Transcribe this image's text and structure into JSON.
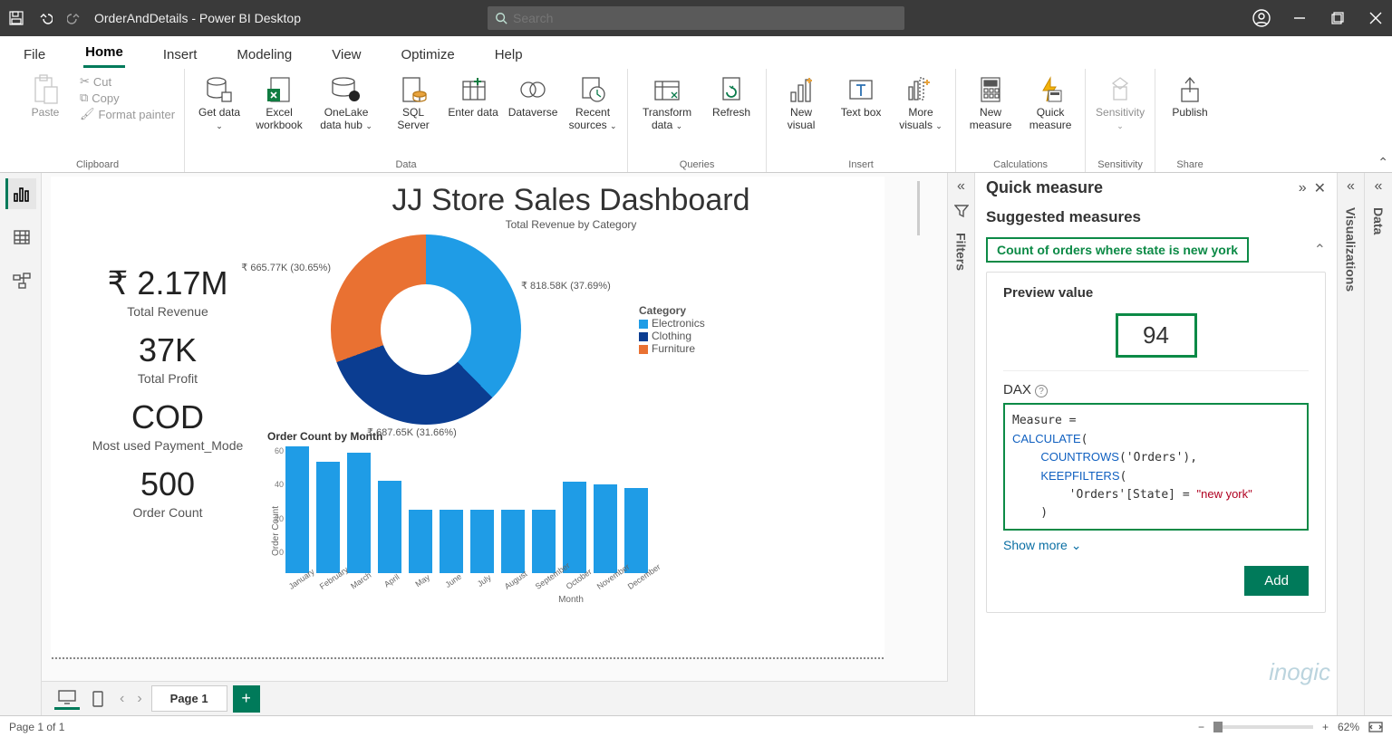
{
  "titlebar": {
    "title": "OrderAndDetails - Power BI Desktop",
    "search_placeholder": "Search"
  },
  "menu": [
    "File",
    "Home",
    "Insert",
    "Modeling",
    "View",
    "Optimize",
    "Help"
  ],
  "ribbon": {
    "clipboard": {
      "paste": "Paste",
      "cut": "Cut",
      "copy": "Copy",
      "format_painter": "Format painter",
      "label": "Clipboard"
    },
    "data": {
      "get_data": "Get data",
      "excel": "Excel workbook",
      "onelake": "OneLake data hub",
      "sql": "SQL Server",
      "enter": "Enter data",
      "dataverse": "Dataverse",
      "recent": "Recent sources",
      "label": "Data"
    },
    "queries": {
      "transform": "Transform data",
      "refresh": "Refresh",
      "label": "Queries"
    },
    "insert": {
      "new_visual": "New visual",
      "text_box": "Text box",
      "more_visuals": "More visuals",
      "label": "Insert"
    },
    "calculations": {
      "new_measure": "New measure",
      "quick_measure": "Quick measure",
      "label": "Calculations"
    },
    "sensitivity": {
      "btn": "Sensitivity",
      "label": "Sensitivity"
    },
    "share": {
      "publish": "Publish",
      "label": "Share"
    }
  },
  "report": {
    "title": "JJ Store Sales Dashboard",
    "kpis": [
      {
        "value": "₹ 2.17M",
        "label": "Total Revenue"
      },
      {
        "value": "37K",
        "label": "Total Profit"
      },
      {
        "value": "COD",
        "label": "Most used Payment_Mode"
      },
      {
        "value": "500",
        "label": "Order Count"
      }
    ],
    "pie_subtitle": "Total Revenue by Category",
    "pie_labels": {
      "left": "₹ 665.77K (30.65%)",
      "right": "₹ 818.58K (37.69%)",
      "bottom": "₹ 687.65K (31.66%)"
    },
    "legend_title": "Category",
    "legend": [
      "Electronics",
      "Clothing",
      "Furniture"
    ],
    "bar_subtitle": "Order Count by Month",
    "bar_ylabel": "Order Count",
    "bar_xlabel": "Month",
    "bar_categories": [
      "January",
      "February",
      "March",
      "April",
      "May",
      "June",
      "July",
      "August",
      "September",
      "October",
      "November",
      "December"
    ],
    "bar_yticks": [
      "60",
      "40",
      "20",
      "0"
    ]
  },
  "chart_data": [
    {
      "type": "pie",
      "title": "Total Revenue by Category",
      "series": [
        {
          "name": "Electronics",
          "value": 818580,
          "label": "₹ 818.58K (37.69%)",
          "color": "#1f9ce6"
        },
        {
          "name": "Clothing",
          "value": 687650,
          "label": "₹ 687.65K (31.66%)",
          "color": "#0b3d91"
        },
        {
          "name": "Furniture",
          "value": 665770,
          "label": "₹ 665.77K (30.65%)",
          "color": "#e97132"
        }
      ]
    },
    {
      "type": "bar",
      "title": "Order Count by Month",
      "xlabel": "Month",
      "ylabel": "Order Count",
      "ylim": [
        0,
        60
      ],
      "categories": [
        "January",
        "February",
        "March",
        "April",
        "May",
        "June",
        "July",
        "August",
        "September",
        "October",
        "November",
        "December"
      ],
      "values": [
        60,
        53,
        57,
        44,
        30,
        30,
        30,
        30,
        30,
        43,
        42,
        40
      ]
    }
  ],
  "filters_label": "Filters",
  "qm": {
    "title": "Quick measure",
    "suggested": "Suggested measures",
    "suggestion": "Count of orders where state is new york",
    "preview_title": "Preview value",
    "preview_value": "94",
    "dax_label": "DAX",
    "dax_code_plain": "Measure =\nCALCULATE(\n    COUNTROWS('Orders'),\n    KEEPFILTERS(\n        'Orders'[State] = \"new york\"\n    )\n",
    "show_more": "Show more",
    "add": "Add"
  },
  "right_panes": {
    "viz": "Visualizations",
    "data": "Data"
  },
  "page_tab": "Page 1",
  "status": {
    "page": "Page 1 of 1",
    "zoom": "62%"
  },
  "watermark": "inogic"
}
